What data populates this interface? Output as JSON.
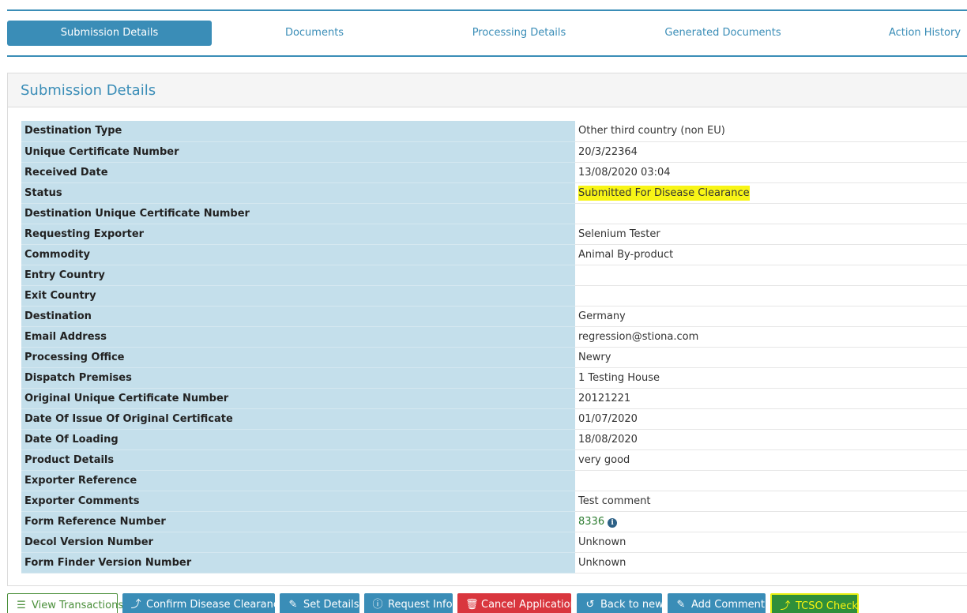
{
  "tabs": [
    {
      "label": "Submission Details",
      "active": true
    },
    {
      "label": "Documents",
      "active": false
    },
    {
      "label": "Processing Details",
      "active": false
    },
    {
      "label": "Generated Documents",
      "active": false
    },
    {
      "label": "Action History",
      "active": false
    }
  ],
  "panel": {
    "title": "Submission Details"
  },
  "rows": [
    {
      "label": "Destination Type",
      "value": "Other third country (non EU)"
    },
    {
      "label": "Unique Certificate Number",
      "value": "20/3/22364"
    },
    {
      "label": "Received Date",
      "value": "13/08/2020 03:04"
    },
    {
      "label": "Status",
      "value": "Submitted For Disease Clearance"
    },
    {
      "label": "Destination Unique Certificate Number",
      "value": ""
    },
    {
      "label": "Requesting Exporter",
      "value": "Selenium Tester"
    },
    {
      "label": "Commodity",
      "value": "Animal By-product"
    },
    {
      "label": "Entry Country",
      "value": ""
    },
    {
      "label": "Exit Country",
      "value": ""
    },
    {
      "label": "Destination",
      "value": "Germany"
    },
    {
      "label": "Email Address",
      "value": "regression@stiona.com"
    },
    {
      "label": "Processing Office",
      "value": "Newry"
    },
    {
      "label": "Dispatch Premises",
      "value": "1 Testing House"
    },
    {
      "label": "Original Unique Certificate Number",
      "value": "20121221"
    },
    {
      "label": "Date Of Issue Of Original Certificate",
      "value": "01/07/2020"
    },
    {
      "label": "Date Of Loading",
      "value": "18/08/2020"
    },
    {
      "label": "Product Details",
      "value": "very good"
    },
    {
      "label": "Exporter Reference",
      "value": ""
    },
    {
      "label": "Exporter Comments",
      "value": "Test comment"
    },
    {
      "label": "Form Reference Number",
      "value": "8336"
    },
    {
      "label": "Decol Version Number",
      "value": "Unknown"
    },
    {
      "label": "Form Finder Version Number",
      "value": "Unknown"
    }
  ],
  "actions": {
    "view_transactions": "View Transactions",
    "confirm_disease_clearance": "Confirm Disease Clearance",
    "set_details": "Set Details",
    "request_info": "Request Info",
    "cancel_application": "Cancel Application",
    "back_to_new": "Back to new",
    "add_comment": "Add Comment",
    "tcso_check": "TCSO Check"
  },
  "colors": {
    "accent": "#3a8db7",
    "label_bg": "#c4dfeb",
    "danger": "#d9363e",
    "highlight": "#f8f516"
  }
}
